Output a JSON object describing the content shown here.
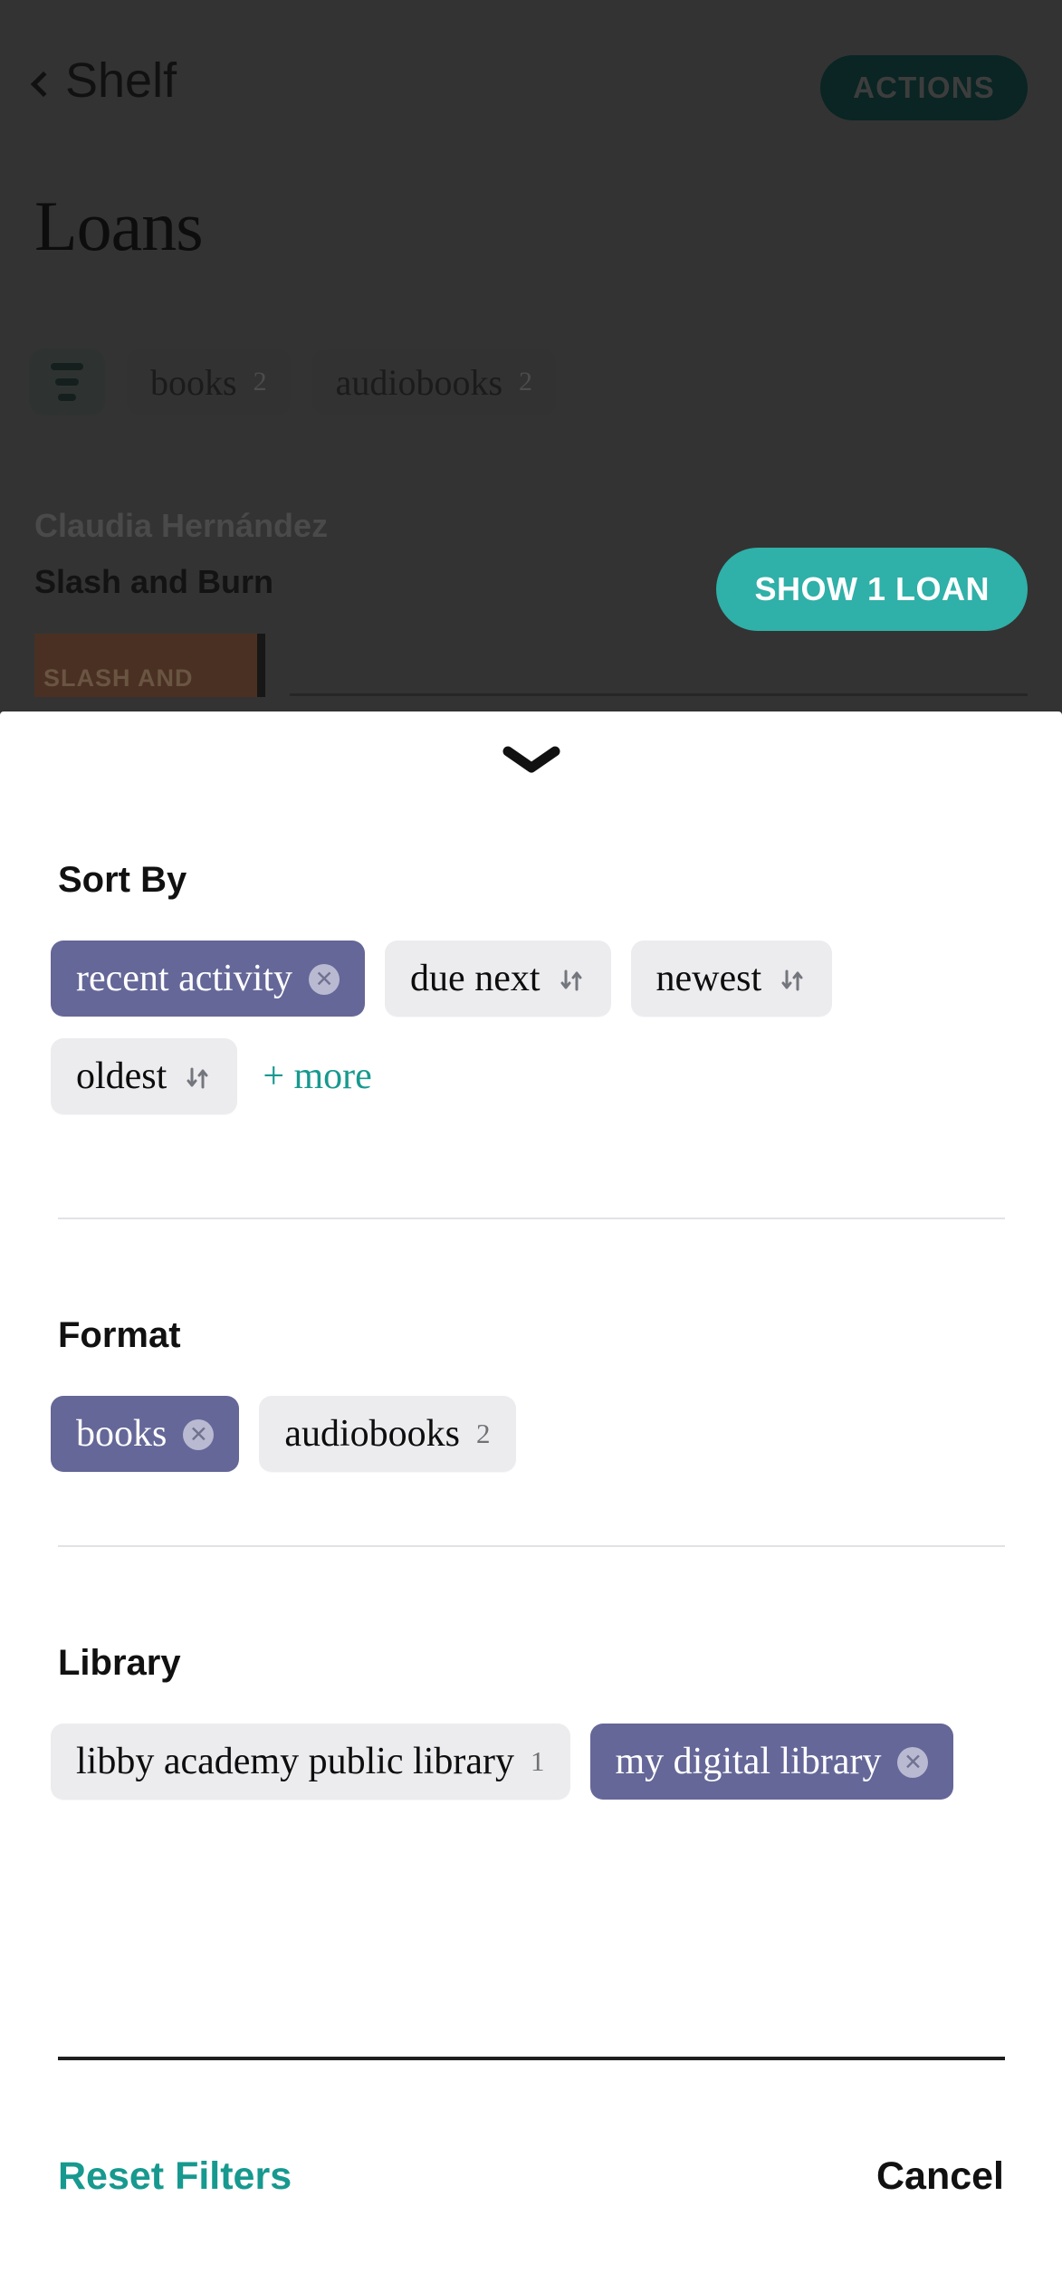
{
  "background": {
    "nav": {
      "back_label": "Shelf",
      "back_icon": "chevron-left-icon",
      "actions_label": "ACTIONS"
    },
    "page_title": "Loans",
    "filter_icon": "filter-lines-icon",
    "tabs": [
      {
        "label": "books",
        "count": "2"
      },
      {
        "label": "audiobooks",
        "count": "2"
      }
    ],
    "loan": {
      "author": "Claudia Hernández",
      "title": "Slash and Burn",
      "cover_text": "SLASH AND BURN",
      "action_label": "SHOW 1 LOAN"
    }
  },
  "sheet": {
    "grabber_icon": "chevron-down-icon",
    "sections": [
      {
        "title": "Sort By",
        "name": "sort-by",
        "chips": [
          {
            "label": "recent activity",
            "selected": true,
            "remove_icon": "close-circle-icon"
          },
          {
            "label": "due next",
            "selected": false,
            "sort_icon": "sort-arrows-icon"
          },
          {
            "label": "newest",
            "selected": false,
            "sort_icon": "sort-arrows-icon"
          },
          {
            "label": "oldest",
            "selected": false,
            "sort_icon": "sort-arrows-icon"
          }
        ],
        "more_label": "+ more"
      },
      {
        "title": "Format",
        "name": "format",
        "chips": [
          {
            "label": "books",
            "selected": true,
            "remove_icon": "close-circle-icon"
          },
          {
            "label": "audiobooks",
            "selected": false,
            "count": "2"
          }
        ]
      },
      {
        "title": "Library",
        "name": "library",
        "chips": [
          {
            "label": "libby academy public library",
            "selected": false,
            "count": "1"
          },
          {
            "label": "my digital library",
            "selected": true,
            "remove_icon": "close-circle-icon"
          }
        ]
      }
    ],
    "footer": {
      "reset_label": "Reset Filters",
      "cancel_label": "Cancel"
    }
  },
  "colors": {
    "accent_teal": "#2fb0a8",
    "link_teal": "#17998f",
    "chip_selected": "#656798",
    "chip_unselected": "#ececef",
    "overlay": "#333333"
  }
}
